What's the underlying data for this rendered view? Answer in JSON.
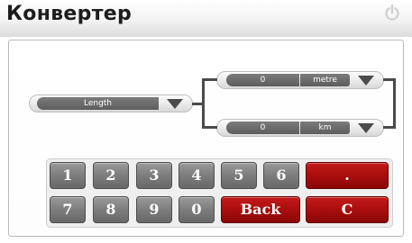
{
  "app": {
    "title": "Конвертер",
    "power_icon": "power-icon"
  },
  "converter": {
    "category": {
      "label": "Length"
    },
    "rows": [
      {
        "value": "0",
        "unit": "metre"
      },
      {
        "value": "0",
        "unit": "km"
      }
    ]
  },
  "keypad": {
    "row1": [
      "1",
      "2",
      "3",
      "4",
      "5",
      "6"
    ],
    "dot": ".",
    "row2": [
      "7",
      "8",
      "9",
      "0"
    ],
    "back": "Back",
    "clear": "C"
  },
  "colors": {
    "key_gray": "#7d7d7d",
    "key_red": "#a60d0d",
    "field_dark": "#5d5d5d"
  }
}
